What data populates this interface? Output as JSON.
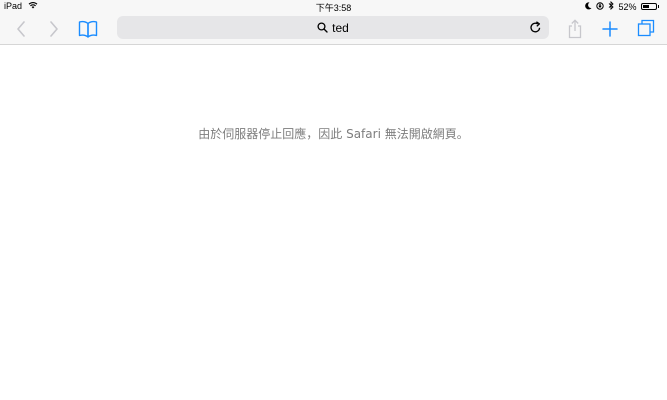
{
  "status_bar": {
    "device": "iPad",
    "time": "下午3:58",
    "battery_text": "52%",
    "battery_level": 0.52
  },
  "toolbar": {
    "address_text": "ted",
    "icons": {
      "back": "chevron-left-icon",
      "forward": "chevron-right-icon",
      "bookmarks": "book-icon",
      "search": "search-icon",
      "reload": "reload-icon",
      "share": "share-icon",
      "new_tab": "plus-icon",
      "tabs": "tabs-icon"
    },
    "accent_color": "#1a8cff",
    "disabled_color": "#c7c7cc"
  },
  "page": {
    "error_message": "由於伺服器停止回應，因此 Safari 無法開啟網頁。"
  }
}
